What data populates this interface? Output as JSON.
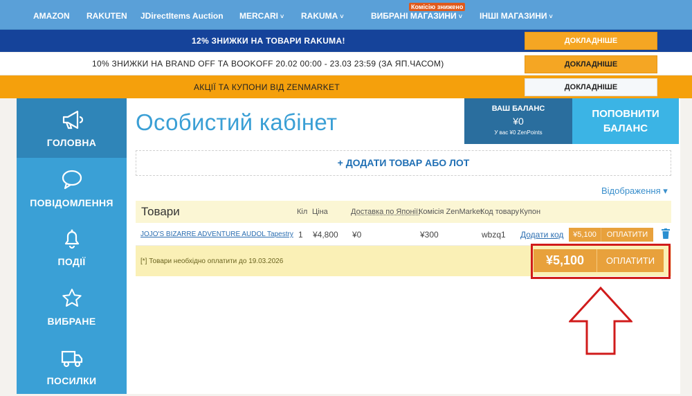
{
  "topnav": {
    "items": [
      {
        "label": "AMAZON"
      },
      {
        "label": "RAKUTEN"
      },
      {
        "label": "JDirectItems Auction"
      },
      {
        "label": "MERCARI"
      },
      {
        "label": "RAKUMA"
      },
      {
        "label": "ВИБРАНІ МАГАЗИНИ"
      },
      {
        "label": "ІНШІ МАГАЗИНИ"
      }
    ],
    "badge": "Комісію знижено"
  },
  "promos": [
    {
      "text": "12% ЗНИЖКИ НА ТОВАРИ RAKUMA!",
      "button": "ДОКЛАДНІШЕ"
    },
    {
      "text": "10% ЗНИЖКИ НА BRAND OFF ТА BOOKOFF 20.02 00:00 - 23.03 23:59 (ЗА ЯП.ЧАСОМ)",
      "button": "ДОКЛАДНІШЕ"
    },
    {
      "text": "АКЦІЇ ТА КУПОНИ ВІД ZENMARKET",
      "button": "ДОКЛАДНІШЕ"
    }
  ],
  "sidebar": {
    "items": [
      {
        "label": "ГОЛОВНА",
        "icon": "megaphone-icon"
      },
      {
        "label": "ПОВІДОМЛЕННЯ",
        "icon": "chat-bubble-icon"
      },
      {
        "label": "ПОДІЇ",
        "icon": "bell-icon"
      },
      {
        "label": "ВИБРАНЕ",
        "icon": "star-icon"
      },
      {
        "label": "ПОСИЛКИ",
        "icon": "truck-icon"
      }
    ]
  },
  "main": {
    "title": "Особистий кабінет",
    "balance": {
      "heading": "ВАШ БАЛАНС",
      "value": "¥0",
      "points": "У вас ¥0 ZenPoints"
    },
    "topup": {
      "line1": "ПОПОВНИТИ",
      "line2": "БАЛАНС"
    },
    "add_item": "+ ДОДАТИ ТОВАР АБО ЛОТ",
    "display_label": "Відображення ▾"
  },
  "table": {
    "title": "Товари",
    "columns": [
      "Кіл",
      "Ціна",
      "Доставка по Японії:",
      "Комісія ZenMarket",
      "Код товару",
      "Купон"
    ],
    "rows": [
      {
        "name": "JOJO'S BIZARRE ADVENTURE AUDOL Tapestry",
        "qty": "1",
        "price": "¥4,800",
        "shipping": "¥0",
        "commission": "¥300",
        "code": "wbzq1",
        "coupon": "Додати код",
        "total": "¥5,100",
        "pay": "ОПЛАТИТИ"
      }
    ],
    "footer": {
      "note": "[*] Товари необхідно оплатити до 19.03.2026",
      "total": "¥5,100",
      "pay": "ОПЛАТИТИ"
    }
  },
  "colors": {
    "topnav": "#5aa0d8",
    "sidebar": "#3aa0d6",
    "accent_orange": "#e8a13c",
    "highlight_red": "#d01b1b"
  }
}
